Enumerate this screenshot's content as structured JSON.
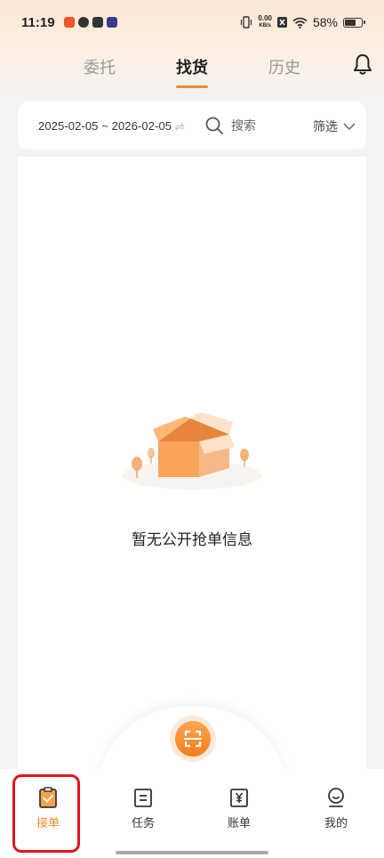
{
  "status_bar": {
    "time": "11:19",
    "net_speed_value": "0.00",
    "net_speed_unit": "KB/s",
    "battery": "58%"
  },
  "tabs": [
    {
      "label": "委托",
      "active": false
    },
    {
      "label": "找货",
      "active": true
    },
    {
      "label": "历史",
      "active": false
    }
  ],
  "filter": {
    "date_range": "2025-02-05 ~ 2026-02-05",
    "search_placeholder": "搜索",
    "filter_label": "筛选"
  },
  "empty_state": {
    "message": "暂无公开抢单信息"
  },
  "bottom_nav": [
    {
      "label": "接单",
      "icon": "clipboard-check-icon",
      "active": true
    },
    {
      "label": "任务",
      "icon": "task-list-icon",
      "active": false
    },
    {
      "label": "账单",
      "icon": "yen-bill-icon",
      "active": false
    },
    {
      "label": "我的",
      "icon": "user-icon",
      "active": false
    }
  ],
  "colors": {
    "accent": "#f08c2c",
    "highlight": "#e0141c"
  }
}
